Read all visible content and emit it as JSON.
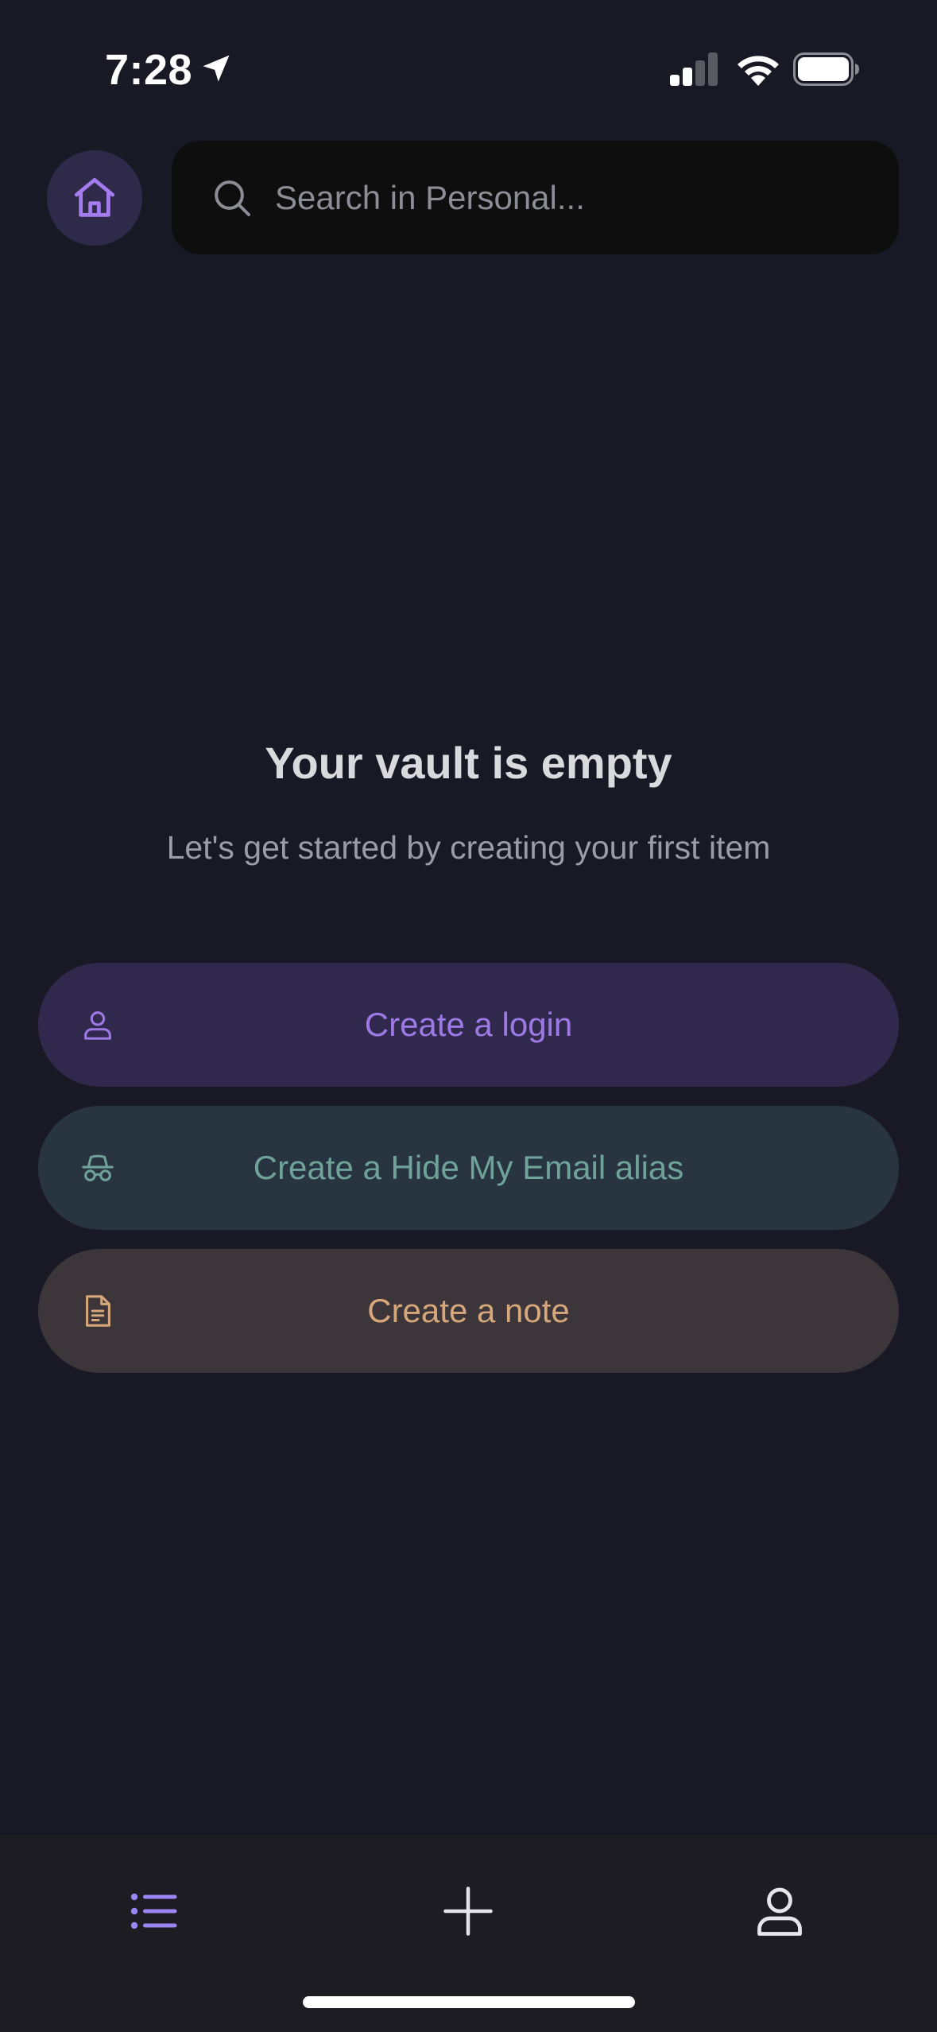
{
  "status_bar": {
    "time": "7:28",
    "location_icon": "location-arrow-icon",
    "signal_icon": "cellular-signal-icon",
    "wifi_icon": "wifi-icon",
    "battery_icon": "battery-icon"
  },
  "header": {
    "home_icon": "home-icon",
    "search": {
      "placeholder": "Search in Personal...",
      "value": "",
      "icon": "search-icon"
    }
  },
  "empty_state": {
    "title": "Your vault is empty",
    "subtitle": "Let's get started by creating your first item"
  },
  "actions": [
    {
      "label": "Create a login",
      "icon": "user-icon",
      "color": "#9d79e6",
      "background": "#31294d"
    },
    {
      "label": "Create a Hide My Email alias",
      "icon": "incognito-icon",
      "color": "#6fa39a",
      "background": "#28343f"
    },
    {
      "label": "Create a note",
      "icon": "note-icon",
      "color": "#d7a77c",
      "background": "#3c3539"
    }
  ],
  "tab_bar": {
    "items": [
      {
        "icon": "list-icon",
        "active": true
      },
      {
        "icon": "plus-icon",
        "active": false
      },
      {
        "icon": "profile-icon",
        "active": false
      }
    ]
  },
  "colors": {
    "background": "#191925",
    "accent": "#9d79e6"
  }
}
